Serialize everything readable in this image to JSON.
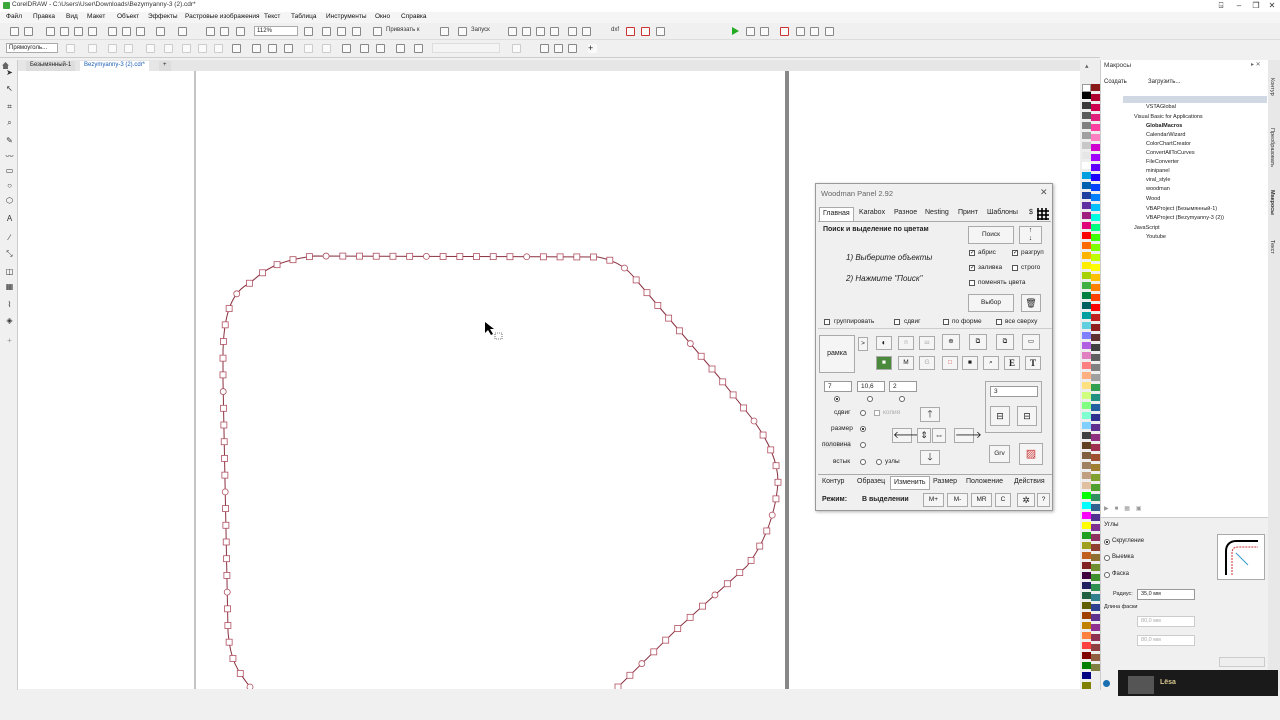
{
  "window": {
    "title": "CorelDRAW - C:\\Users\\User\\Downloads\\Bezymyanny-3 (2).cdr*"
  },
  "menu": [
    "Файл",
    "Правка",
    "Вид",
    "Макет",
    "Объект",
    "Эффекты",
    "Растровые изображения",
    "Текст",
    "Таблица",
    "Инструменты",
    "Окно",
    "Справка"
  ],
  "toolbar": {
    "zoom": "112%",
    "snap_label": "Привязать к",
    "launch_label": "Запуск",
    "dxf_label": "dxf"
  },
  "propertybar": {
    "shape_select": "Прямоуголь..."
  },
  "doc_tabs": [
    "Безымянный-1",
    "Bezymyanny-3 (2).cdr*"
  ],
  "macros": {
    "title": "Макросы",
    "create": "Создать",
    "load": "Загрузить...",
    "tree": [
      "VSTAGlobal",
      "Visual Basic for Applications",
      "GlobalMacros",
      "CalendarWizard",
      "ColorChartCreator",
      "ConvertAllToCurves",
      "FileConverter",
      "minipanel",
      "viral_style",
      "woodman",
      "Wood",
      "VBAProject (Безымянный-1)",
      "VBAProject (Bezymyanny-3 (2))",
      "JavaScript",
      "Youtube"
    ]
  },
  "nodes": {
    "title": "Углы",
    "opt_round": "Скругление",
    "opt_scallop": "Выемка",
    "opt_chamfer": "Фаска",
    "radius_label": "Радиус:",
    "radius_value": "35,0 мм",
    "chamfer_label": "Длина фаски",
    "a_value": "80,0 мм",
    "b_value": "80,0 мм"
  },
  "docker_tabs": [
    "Контур",
    "Преобразовать",
    "Макросы",
    "Текст"
  ],
  "woodman": {
    "title": "Woodman Panel 2.92",
    "tabs": [
      "Главная",
      "Karabox",
      "Разное",
      "Nesting",
      "Принт",
      "Шаблоны",
      "$"
    ],
    "section": "Поиск и выделение по цветам",
    "step1": "1) Выберите объекты",
    "step2": "2) Нажмите \"Поиск\"",
    "search_btn": "Поиск",
    "select_btn": "Выбор",
    "chk_outline": "абрис",
    "chk_ungroup": "разгруп",
    "chk_fill": "заливка",
    "chk_strict": "строго",
    "chk_swap": "поменять цвета",
    "chk_group": "группировать",
    "chk_shift": "сдвиг",
    "chk_byshape": "по форме",
    "chk_top": "все сверху",
    "frame_btn": "рамка",
    "inputs": [
      "7",
      "10,6",
      "2"
    ],
    "count": "3",
    "r_shift": "сдвиг",
    "r_copy": "копия",
    "r_size": "размер",
    "r_half": "половина",
    "r_butt": "встык",
    "r_nodes": "узлы",
    "grv": "Grv",
    "bottom_tabs": [
      "Контур",
      "Образец",
      "Изменить",
      "Размер",
      "Положение",
      "Действия"
    ],
    "mode_label": "Режим:",
    "mode_value": "В выделении",
    "mbuttons": [
      "M+",
      "M-",
      "MR",
      "C"
    ],
    "help": "?"
  },
  "notification": {
    "name": "Lёsa"
  }
}
